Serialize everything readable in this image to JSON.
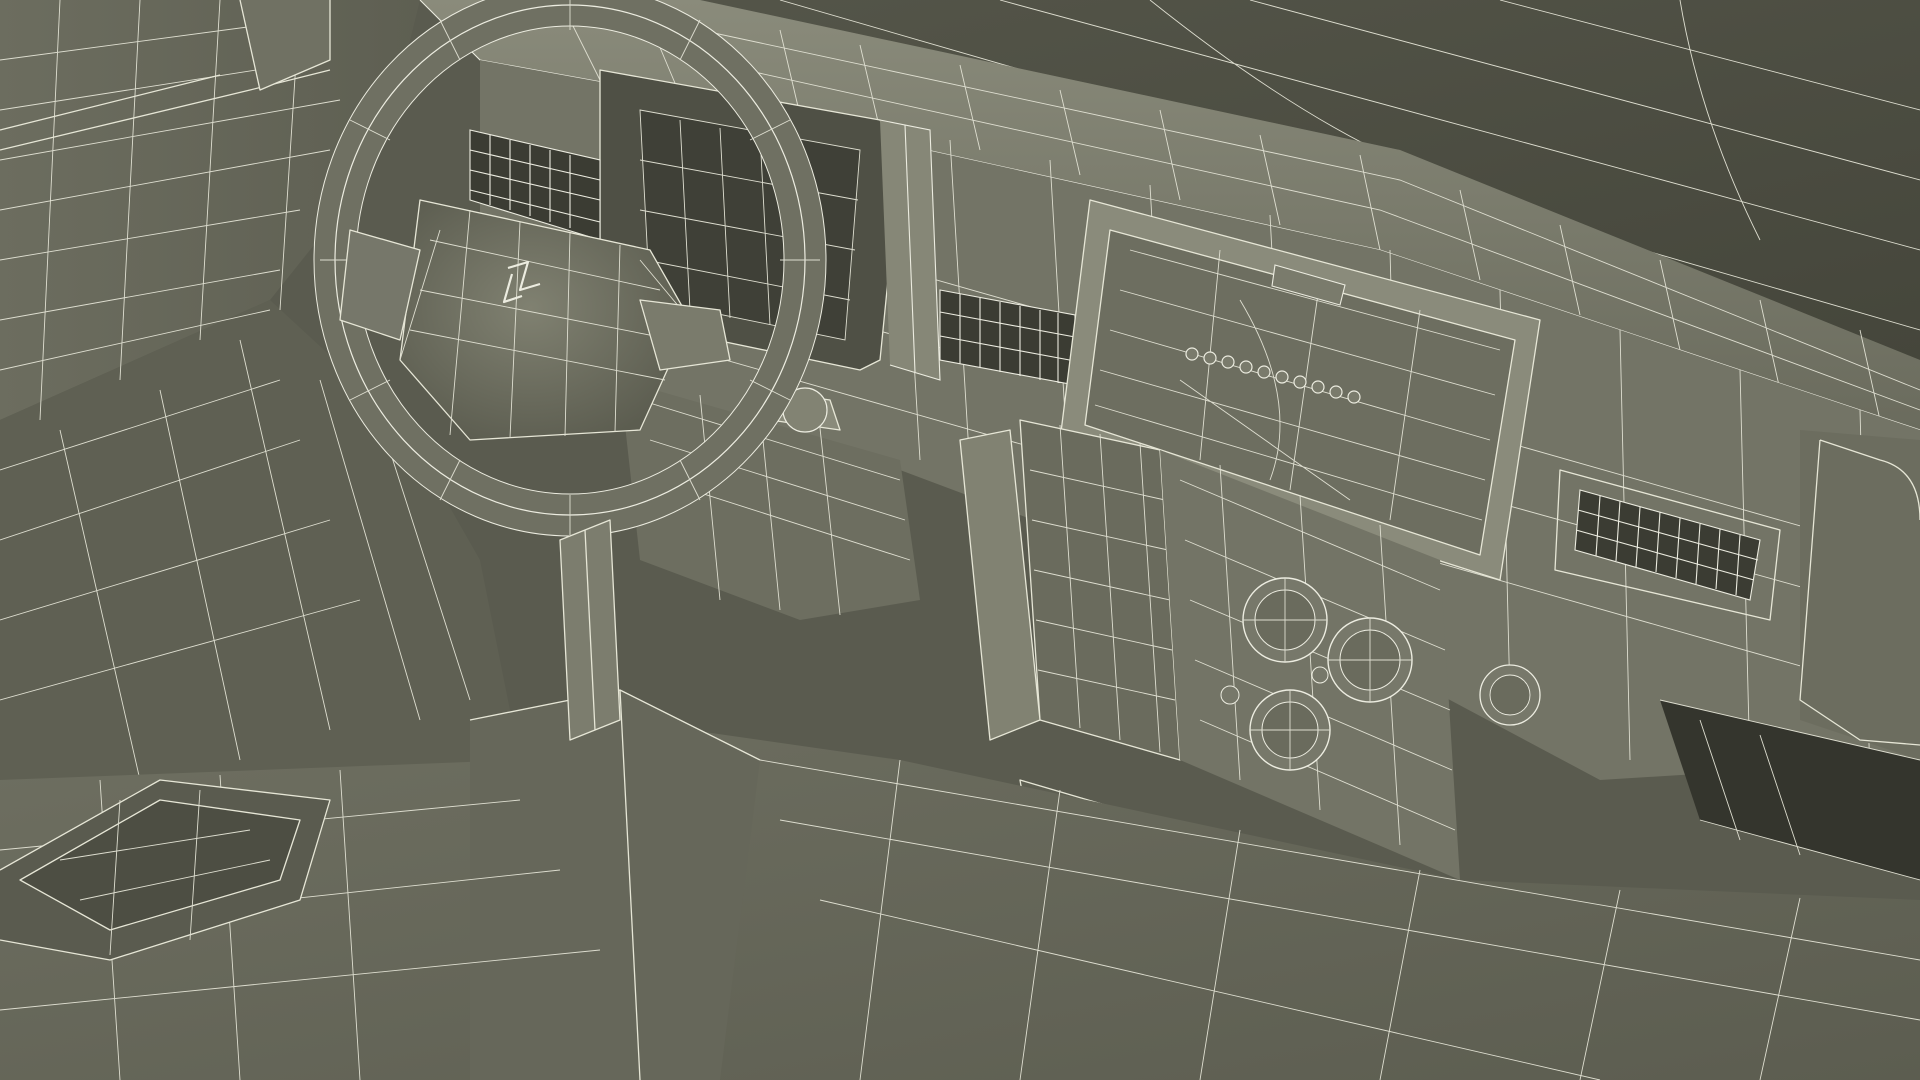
{
  "render": {
    "subject": "car-interior-dashboard",
    "view": "wireframe-over-shaded",
    "palette": {
      "background": "#5a5b4f",
      "surface_light": "#7c7d6e",
      "surface_mid": "#66675a",
      "surface_dark": "#4a4b40",
      "surface_deep": "#3a3b32",
      "wire": "#e6e6d6"
    }
  }
}
